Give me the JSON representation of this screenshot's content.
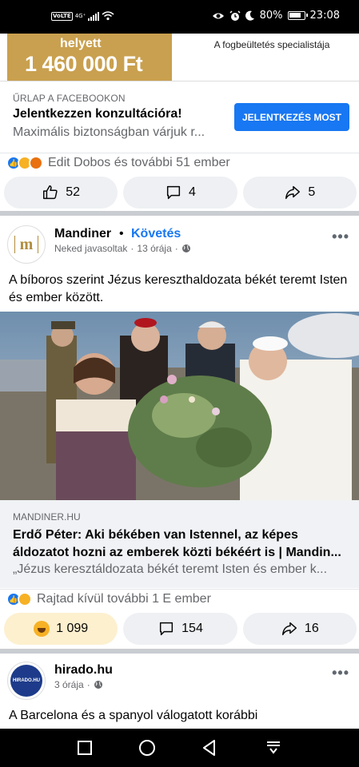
{
  "status_bar": {
    "volte": "VoLTE",
    "network": "4G⁺",
    "battery": "80%",
    "time": "23:08"
  },
  "ad": {
    "image_line1": "helyett",
    "image_price": "1 460 000 Ft",
    "image_right_text": "A fogbeültetés specialistája",
    "source": "ŰRLAP A FACEBOOKON",
    "title": "Jelentkezzen konzultációra!",
    "description": "Maximális biztonságban várjuk r...",
    "cta": "JELENTKEZÉS MOST",
    "reactions_text": "Edit Dobos és további 51 ember",
    "likes": "52",
    "comments": "4",
    "shares": "5"
  },
  "post1": {
    "page_name": "Mandiner",
    "dot": "•",
    "follow": "Követés",
    "meta_suggested": "Neked javasoltak",
    "meta_sep": "·",
    "meta_time": "13 órája",
    "meta_sep2": "·",
    "more": "•••",
    "text": "A bíboros szerint Jézus kereszthaldozata békét teremt Isten és ember között.",
    "link_source": "MANDINER.HU",
    "link_title": "Erdő Péter: Aki békében van Istennel, az képes áldozatot hozni az emberek közti békéért is | Mandin...",
    "link_desc": "„Jézus keresztáldozata békét teremt Isten és ember k...",
    "reactions_text": "Rajtad kívül további 1 E ember",
    "reactions": "1 099",
    "comments": "154",
    "shares": "16"
  },
  "post2": {
    "page_name": "hirado.hu",
    "avatar_text": "HIRADO.HU",
    "meta_time": "3 órája",
    "meta_sep": "·",
    "more": "•••",
    "text": "A Barcelona és a spanyol válogatott korábbi"
  },
  "colors": {
    "facebook_blue": "#1877f2",
    "ad_gold": "#c9a04f",
    "haha_yellow": "#f7b125"
  }
}
